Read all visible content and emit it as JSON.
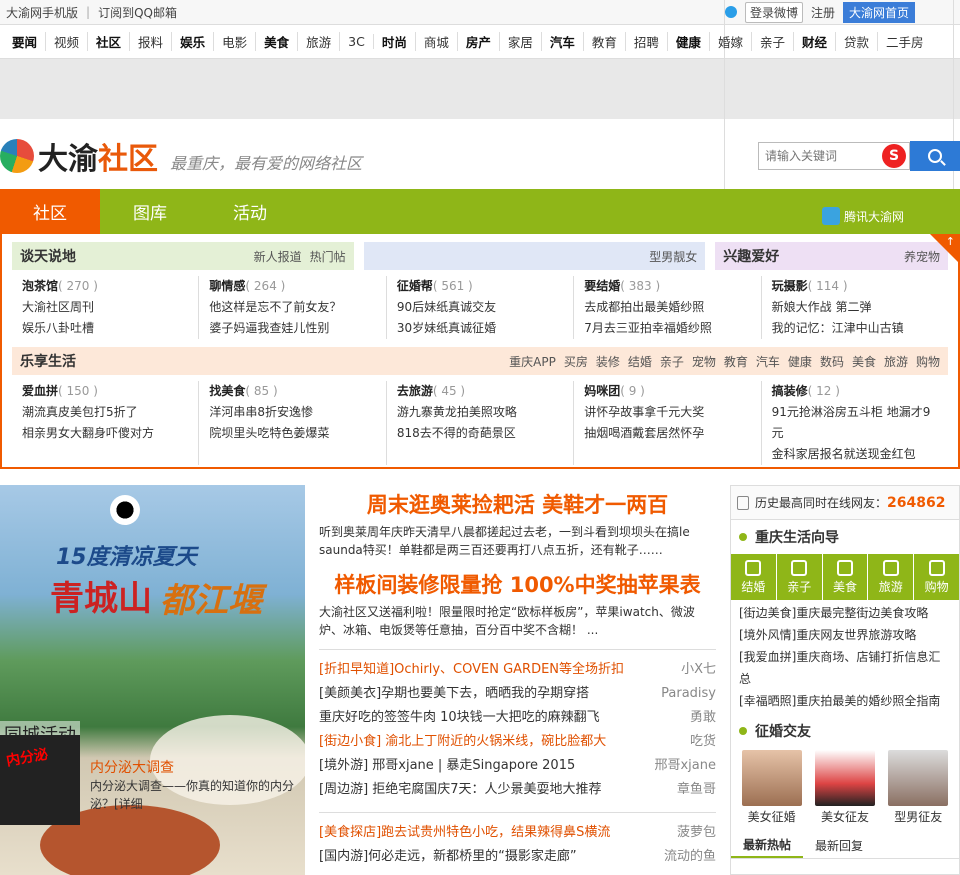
{
  "topbar": {
    "mobile": "大渝网手机版",
    "subscribe": "订阅到QQ邮箱",
    "weibo_login": "登录微博",
    "register": "注册",
    "home": "大渝网首页"
  },
  "nav": [
    {
      "label": "要闻",
      "bold": true
    },
    {
      "label": "视频"
    },
    {
      "label": "社区",
      "bold": true
    },
    {
      "label": "报料"
    },
    {
      "label": "娱乐",
      "bold": true
    },
    {
      "label": "电影"
    },
    {
      "label": "美食",
      "bold": true
    },
    {
      "label": "旅游"
    },
    {
      "label": "3C"
    },
    {
      "label": "时尚",
      "bold": true
    },
    {
      "label": "商城"
    },
    {
      "label": "房产",
      "bold": true
    },
    {
      "label": "家居"
    },
    {
      "label": "汽车",
      "bold": true
    },
    {
      "label": "教育"
    },
    {
      "label": "招聘"
    },
    {
      "label": "健康",
      "bold": true
    },
    {
      "label": "婚嫁"
    },
    {
      "label": "亲子"
    },
    {
      "label": "财经",
      "bold": true
    },
    {
      "label": "贷款"
    },
    {
      "label": "二手房"
    }
  ],
  "header": {
    "logo_part1": "大渝",
    "logo_part2": "社区",
    "slogan": "最重庆，最有爱的网络社区",
    "search_placeholder": "请输入关键词",
    "search_brand": "S"
  },
  "greenbar": {
    "tabs": [
      "社区",
      "图库",
      "活动"
    ],
    "tencent": "腾讯大渝网"
  },
  "board": {
    "heads": [
      {
        "title": "谈天说地",
        "links": [
          "新人报道",
          "热门帖"
        ],
        "bg": "#e4f0d6"
      },
      {
        "title": "",
        "links": [
          "型男靓女"
        ],
        "bg": "#e0e7f6"
      },
      {
        "title": "兴趣爱好",
        "links": [
          "养宠物"
        ],
        "bg": "#eee0f4"
      }
    ],
    "row1": [
      {
        "name": "泡茶馆",
        "count": "( 270 )",
        "lines": [
          "大渝社区周刊",
          "娱乐八卦吐槽"
        ]
      },
      {
        "name": "聊情感",
        "count": "( 264 )",
        "lines": [
          "他这样是忘不了前女友？",
          "婆子妈逼我查娃儿性别"
        ]
      },
      {
        "name": "征婚帮",
        "count": "( 561 )",
        "lines": [
          "90后妹纸真诚交友",
          "30岁妹纸真诚征婚"
        ]
      },
      {
        "name": "要结婚",
        "count": "( 383 )",
        "lines": [
          "去成都拍出最美婚纱照",
          "7月去三亚拍幸福婚纱照"
        ]
      },
      {
        "name": "玩摄影",
        "count": "( 114 )",
        "lines": [
          "新娘大作战 第二弹",
          "我的记忆：江津中山古镇"
        ]
      }
    ],
    "life": {
      "title": "乐享生活",
      "links": [
        "重庆APP",
        "买房",
        "装修",
        "结婚",
        "亲子",
        "宠物",
        "教育",
        "汽车",
        "健康",
        "数码",
        "美食",
        "旅游",
        "购物"
      ]
    },
    "row2": [
      {
        "name": "爱血拼",
        "count": "( 150 )",
        "lines": [
          "潮流真皮美包打5折了",
          "相亲男女大翻身吓傻对方"
        ]
      },
      {
        "name": "找美食",
        "count": "( 85 )",
        "lines": [
          "洋河串串8折安逸惨",
          "院坝里头吃特色姜爆菜"
        ]
      },
      {
        "name": "去旅游",
        "count": "( 45 )",
        "lines": [
          "游九寨黄龙拍美照攻略",
          "818去不得的奇葩景区"
        ]
      },
      {
        "name": "妈咪团",
        "count": "( 9 )",
        "lines": [
          "讲怀孕故事拿千元大奖",
          "抽烟喝酒戴套居然怀孕"
        ]
      },
      {
        "name": "搞装修",
        "count": "( 12 )",
        "lines": [
          "91元抢淋浴房五斗柜 地漏才9元",
          "金科家居报名就送现金红包"
        ]
      }
    ]
  },
  "promo": {
    "line1": "15度清凉夏天",
    "line2": "青城山",
    "line3": "都江堰",
    "activity": "同城活动",
    "act_pic_text": "内分泌",
    "act_title": "内分泌大调查",
    "act_desc": "内分泌大调查——你真的知道你的内分泌？[详细"
  },
  "center": {
    "h1": "周末逛奥莱捡耙活 美鞋才一两百",
    "d1": "听到奥莱周年庆昨天清早八晨都搓起过去老，一到斗看到坝坝头在搞le saunda特买！单鞋都是两三百还要再打八点五折，还有靴子……",
    "h2": "样板间装修限量抢 100%中奖抽苹果表",
    "d2": "大渝社区又送福利啦！限量限时抢定“欧标样板房”，苹果iwatch、微波炉、冰箱、电饭煲等任意抽，百分百中奖不含糊！ ...",
    "list1": [
      {
        "title": "[折扣早知道]Ochirly、COVEN GARDEN等全场折扣",
        "author": "小X七",
        "hl": true
      },
      {
        "title": "[美颜美衣]孕期也要美下去，晒晒我的孕期穿搭",
        "author": "Paradisy"
      },
      {
        "title": "重庆好吃的签签牛肉 10块钱一大把吃的麻辣翻飞",
        "author": "勇敢"
      },
      {
        "title": "[街边小食] 渝北上丁附近的火锅米线，碗比脸都大",
        "author": "吃货",
        "hl": true
      },
      {
        "title": "[境外游] 邢哥xjane | 暴走Singapore 2015",
        "author": "邢哥xjane"
      },
      {
        "title": "[周边游] 拒绝宅腐国庆7天：人少景美耍地大推荐",
        "author": "章鱼哥"
      }
    ],
    "list2": [
      {
        "title": "[美食探店]跑去试贵州特色小吃，结果辣得鼻S横流",
        "author": "菠萝包",
        "hl": true
      },
      {
        "title": "[国内游]何必走远，新都桥里的“摄影家走廊”",
        "author": "流动的鱼"
      }
    ]
  },
  "right": {
    "online_label": "历史最高同时在线网友：",
    "online_value": "264862",
    "guide_title": "重庆生活向导",
    "guide": [
      "结婚",
      "亲子",
      "美食",
      "旅游",
      "购物"
    ],
    "guide_links": [
      "[街边美食]重庆最完整街边美食攻略",
      "[境外风情]重庆网友世界旅游攻略",
      "[我爱血拼]重庆商场、店铺打折信息汇总",
      "[幸福晒照]重庆拍最美的婚纱照全指南"
    ],
    "marry_title": "征婚交友",
    "people": [
      "美女征婚",
      "美女征友",
      "型男征友"
    ],
    "tabs": [
      "最新热帖",
      "最新回复"
    ]
  }
}
